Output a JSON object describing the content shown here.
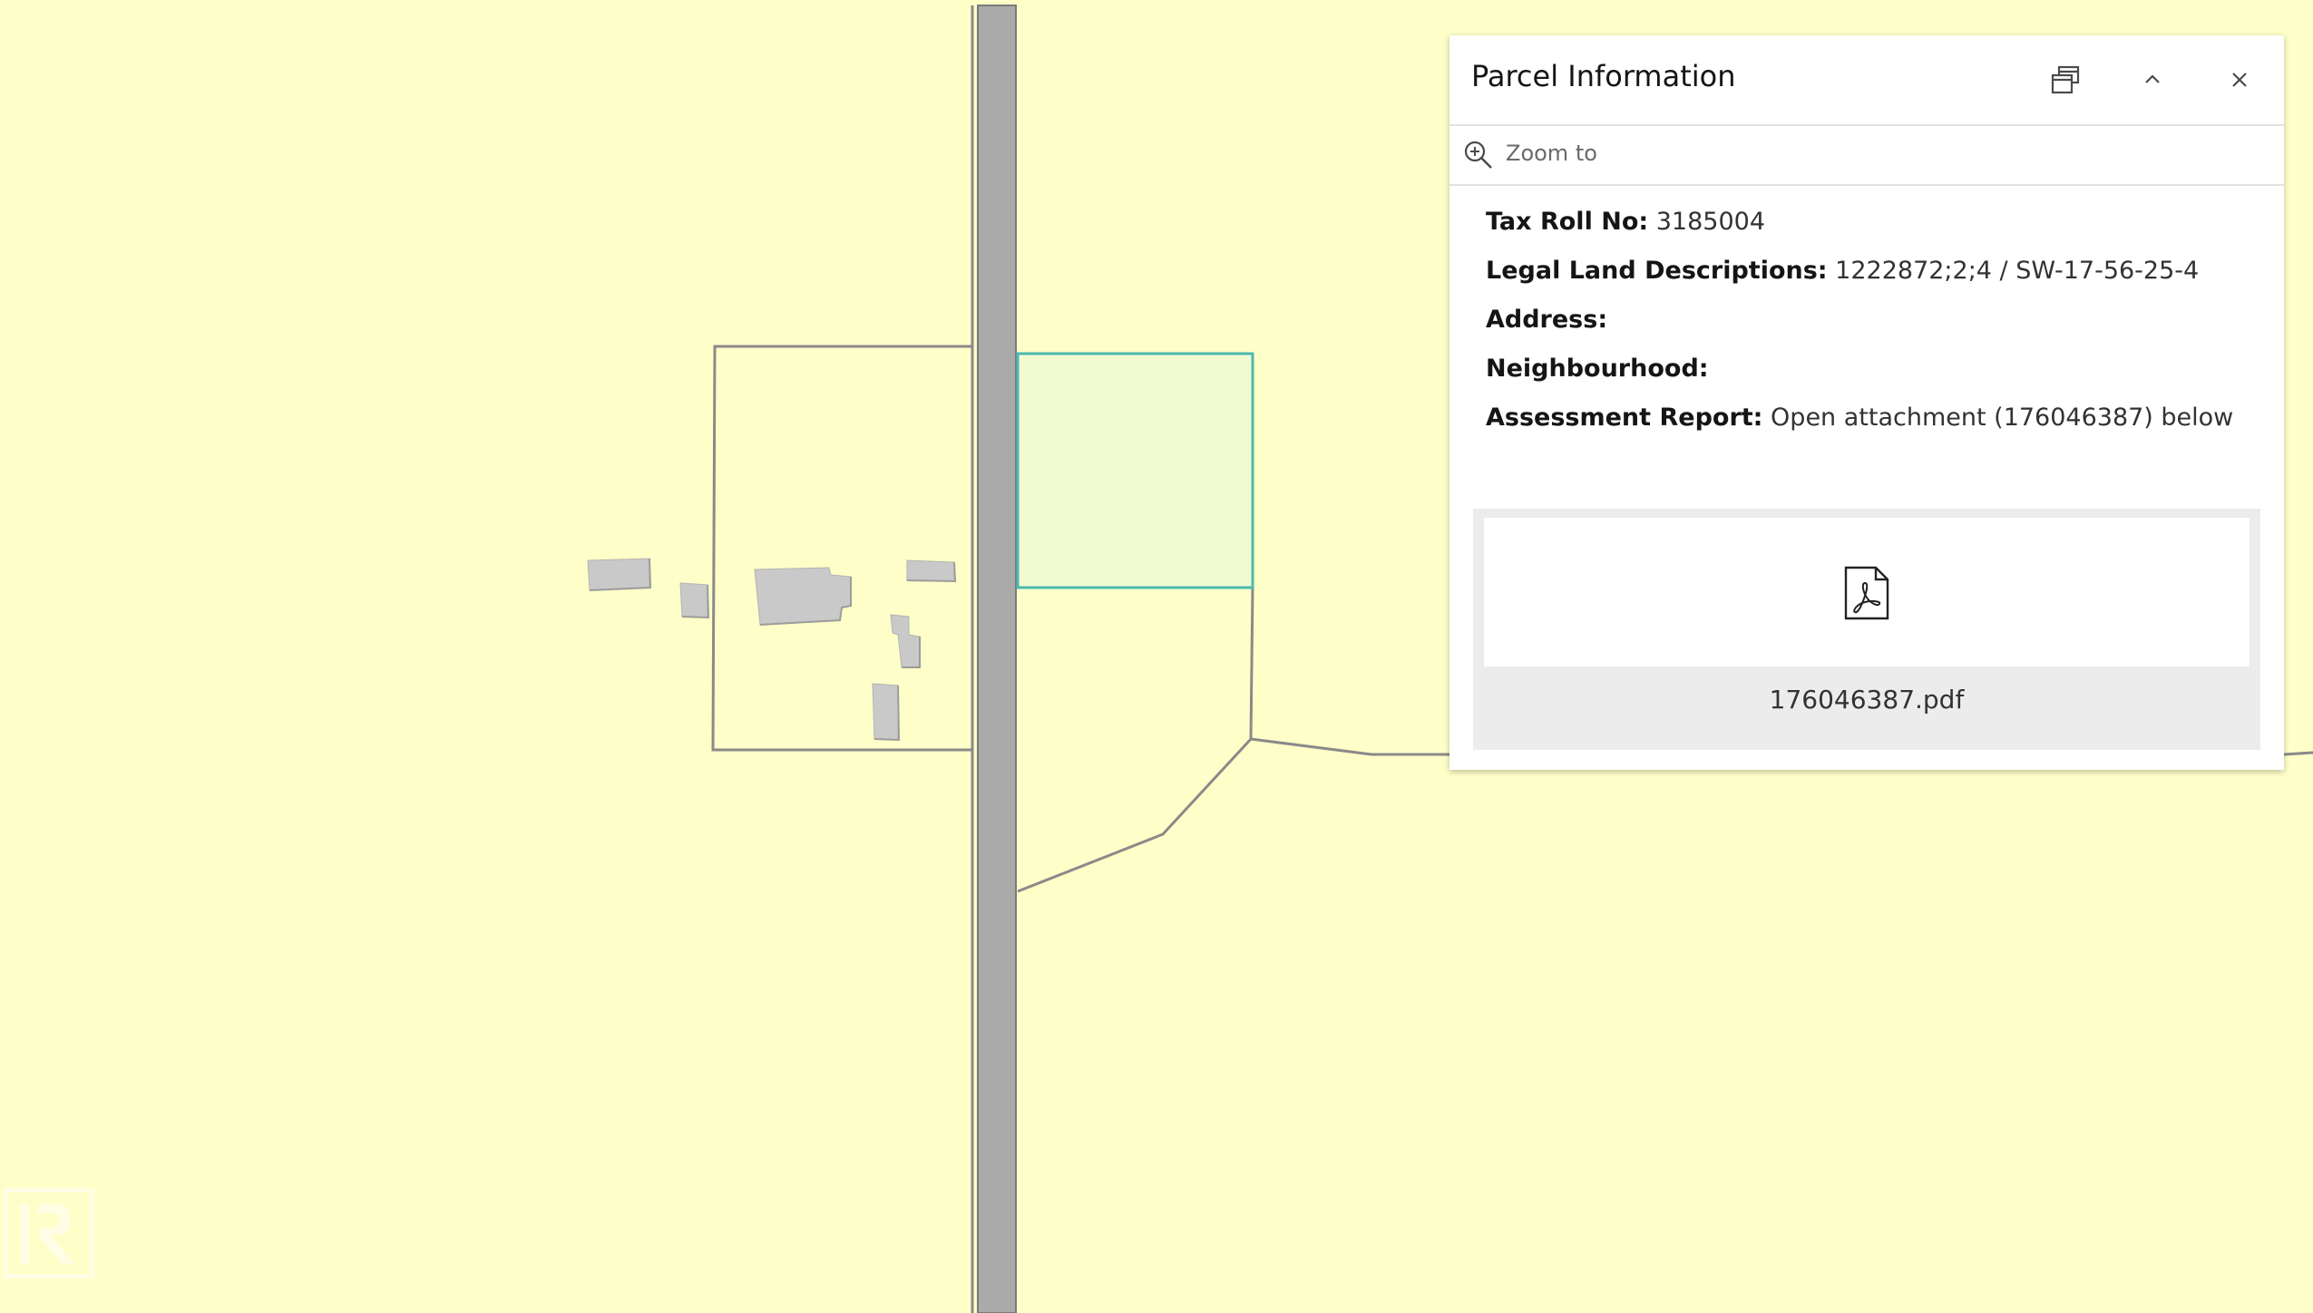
{
  "colors": {
    "map_background": "#fefec8",
    "selected_parcel_fill": "#f2fbd0",
    "selected_parcel_stroke": "#4fb8b3",
    "parcel_line": "#8a8a8a",
    "road_fill": "#aaaaaa",
    "building_fill": "#c9c9c9"
  },
  "map": {
    "buildings_count": 7
  },
  "popup": {
    "title": "Parcel Information",
    "dock_icon": "dock-icon",
    "collapse_icon": "chevron-up-icon",
    "close_icon": "close-icon",
    "zoom_icon": "zoom-in-icon",
    "zoom_label": "Zoom to",
    "attributes": [
      {
        "key": "Tax Roll No:",
        "value": " 3185004"
      },
      {
        "key": "Legal Land Descriptions:",
        "value": " 1222872;2;4 / SW-17-56-25-4"
      },
      {
        "key": "Address:",
        "value": ""
      },
      {
        "key": "Neighbourhood:",
        "value": ""
      },
      {
        "key": "Assessment Report:",
        "value": " Open attachment (176046387) below"
      }
    ],
    "attachment": {
      "icon": "pdf-icon",
      "filename": "176046387.pdf"
    }
  }
}
